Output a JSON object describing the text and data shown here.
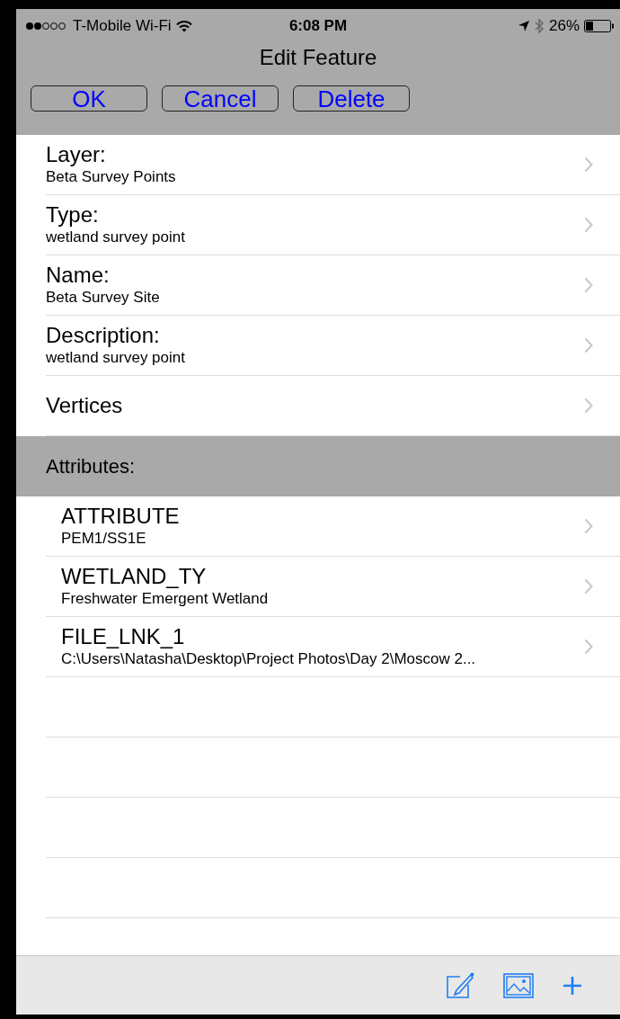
{
  "status_bar": {
    "carrier": "T-Mobile Wi-Fi",
    "time": "6:08 PM",
    "battery": "26%"
  },
  "nav": {
    "title": "Edit Feature"
  },
  "buttons": [
    "OK",
    "Cancel",
    "Delete"
  ],
  "fields": [
    {
      "label": "Layer:",
      "value": "Beta Survey Points"
    },
    {
      "label": "Type:",
      "value": "wetland survey point"
    },
    {
      "label": "Name:",
      "value": "Beta Survey Site"
    },
    {
      "label": "Description:",
      "value": "wetland survey point"
    },
    {
      "label": "Vertices"
    }
  ],
  "attributes_header": "Attributes:",
  "attributes": [
    {
      "label": "ATTRIBUTE",
      "value": "PEM1/SS1E"
    },
    {
      "label": "WETLAND_TY",
      "value": "Freshwater Emergent Wetland"
    },
    {
      "label": "FILE_LNK_1",
      "value": "C:\\Users\\Natasha\\Desktop\\Project Photos\\Day 2\\Moscow 2..."
    }
  ]
}
